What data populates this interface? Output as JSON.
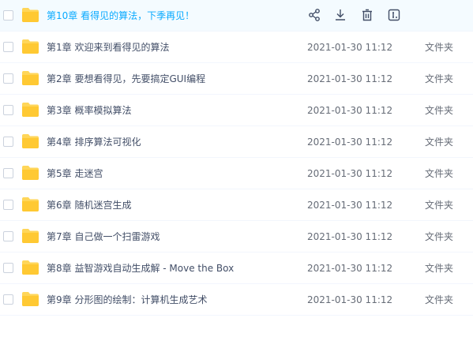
{
  "files": [
    {
      "name": "第10章 看得见的算法，下季再见！",
      "date": "",
      "type": "",
      "hovered": true
    },
    {
      "name": "第1章 欢迎来到看得见的算法",
      "date": "2021-01-30 11:12",
      "type": "文件夹"
    },
    {
      "name": "第2章 要想看得见，先要搞定GUI编程",
      "date": "2021-01-30 11:12",
      "type": "文件夹"
    },
    {
      "name": "第3章 概率模拟算法",
      "date": "2021-01-30 11:12",
      "type": "文件夹"
    },
    {
      "name": "第4章 排序算法可视化",
      "date": "2021-01-30 11:12",
      "type": "文件夹"
    },
    {
      "name": "第5章 走迷宫",
      "date": "2021-01-30 11:12",
      "type": "文件夹"
    },
    {
      "name": "第6章 随机迷宫生成",
      "date": "2021-01-30 11:12",
      "type": "文件夹"
    },
    {
      "name": "第7章 自己做一个扫雷游戏",
      "date": "2021-01-30 11:12",
      "type": "文件夹"
    },
    {
      "name": "第8章 益智游戏自动生成解 - Move the Box",
      "date": "2021-01-30 11:12",
      "type": "文件夹"
    },
    {
      "name": "第9章 分形图的绘制：计算机生成艺术",
      "date": "2021-01-30 11:12",
      "type": "文件夹"
    }
  ],
  "row_actions": [
    "share-icon",
    "download-icon",
    "delete-icon",
    "rename-icon"
  ],
  "colors": {
    "folder": "#ffd659",
    "hover_name": "#09aaff",
    "text": "#424e67",
    "meta": "#666c77"
  }
}
